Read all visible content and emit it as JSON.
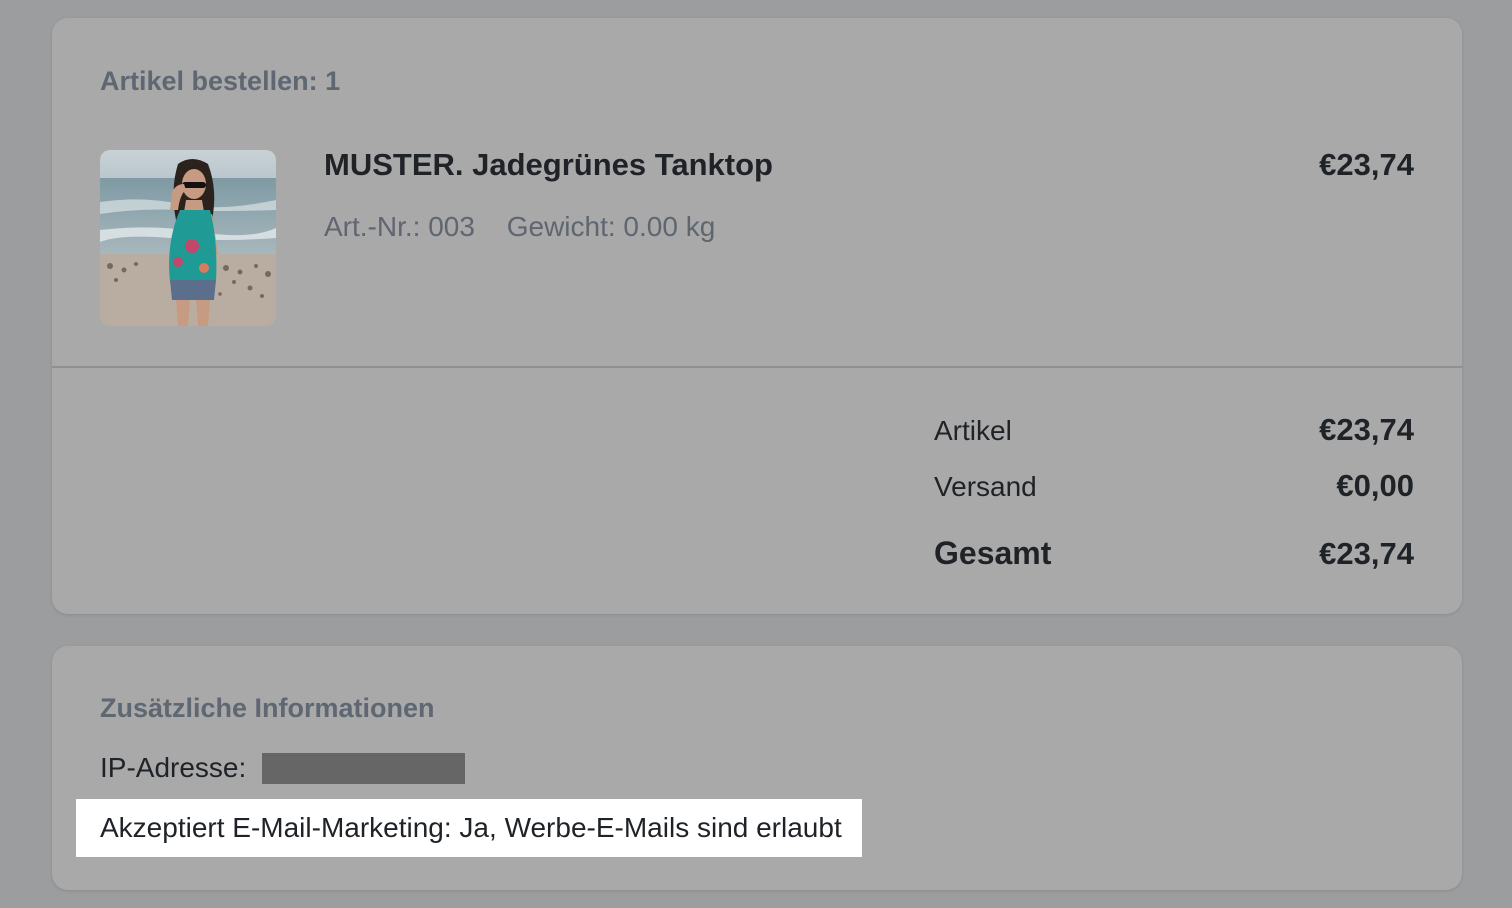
{
  "order": {
    "heading": "Artikel bestellen: 1",
    "product": {
      "image": "product-photo",
      "name": "MUSTER. Jadegrünes Tanktop",
      "sku": "Art.-Nr.: 003",
      "weight": "Gewicht: 0.00 kg",
      "price": "€23,74"
    },
    "summary": {
      "items_label": "Artikel",
      "items_value": "€23,74",
      "shipping_label": "Versand",
      "shipping_value": "€0,00",
      "total_label": "Gesamt",
      "total_value": "€23,74"
    }
  },
  "info": {
    "heading": "Zusätzliche Informationen",
    "ip_label": "IP-Adresse:",
    "marketing": "Akzeptiert E-Mail-Marketing: Ja, Werbe-E-Mails sind erlaubt"
  },
  "colors": {
    "backdrop": "#9c9d9f",
    "card": "#a9a9a9",
    "heading": "#5e6772",
    "text": "#1f2327",
    "highlight": "#ffffff",
    "redaction": "#666666"
  }
}
